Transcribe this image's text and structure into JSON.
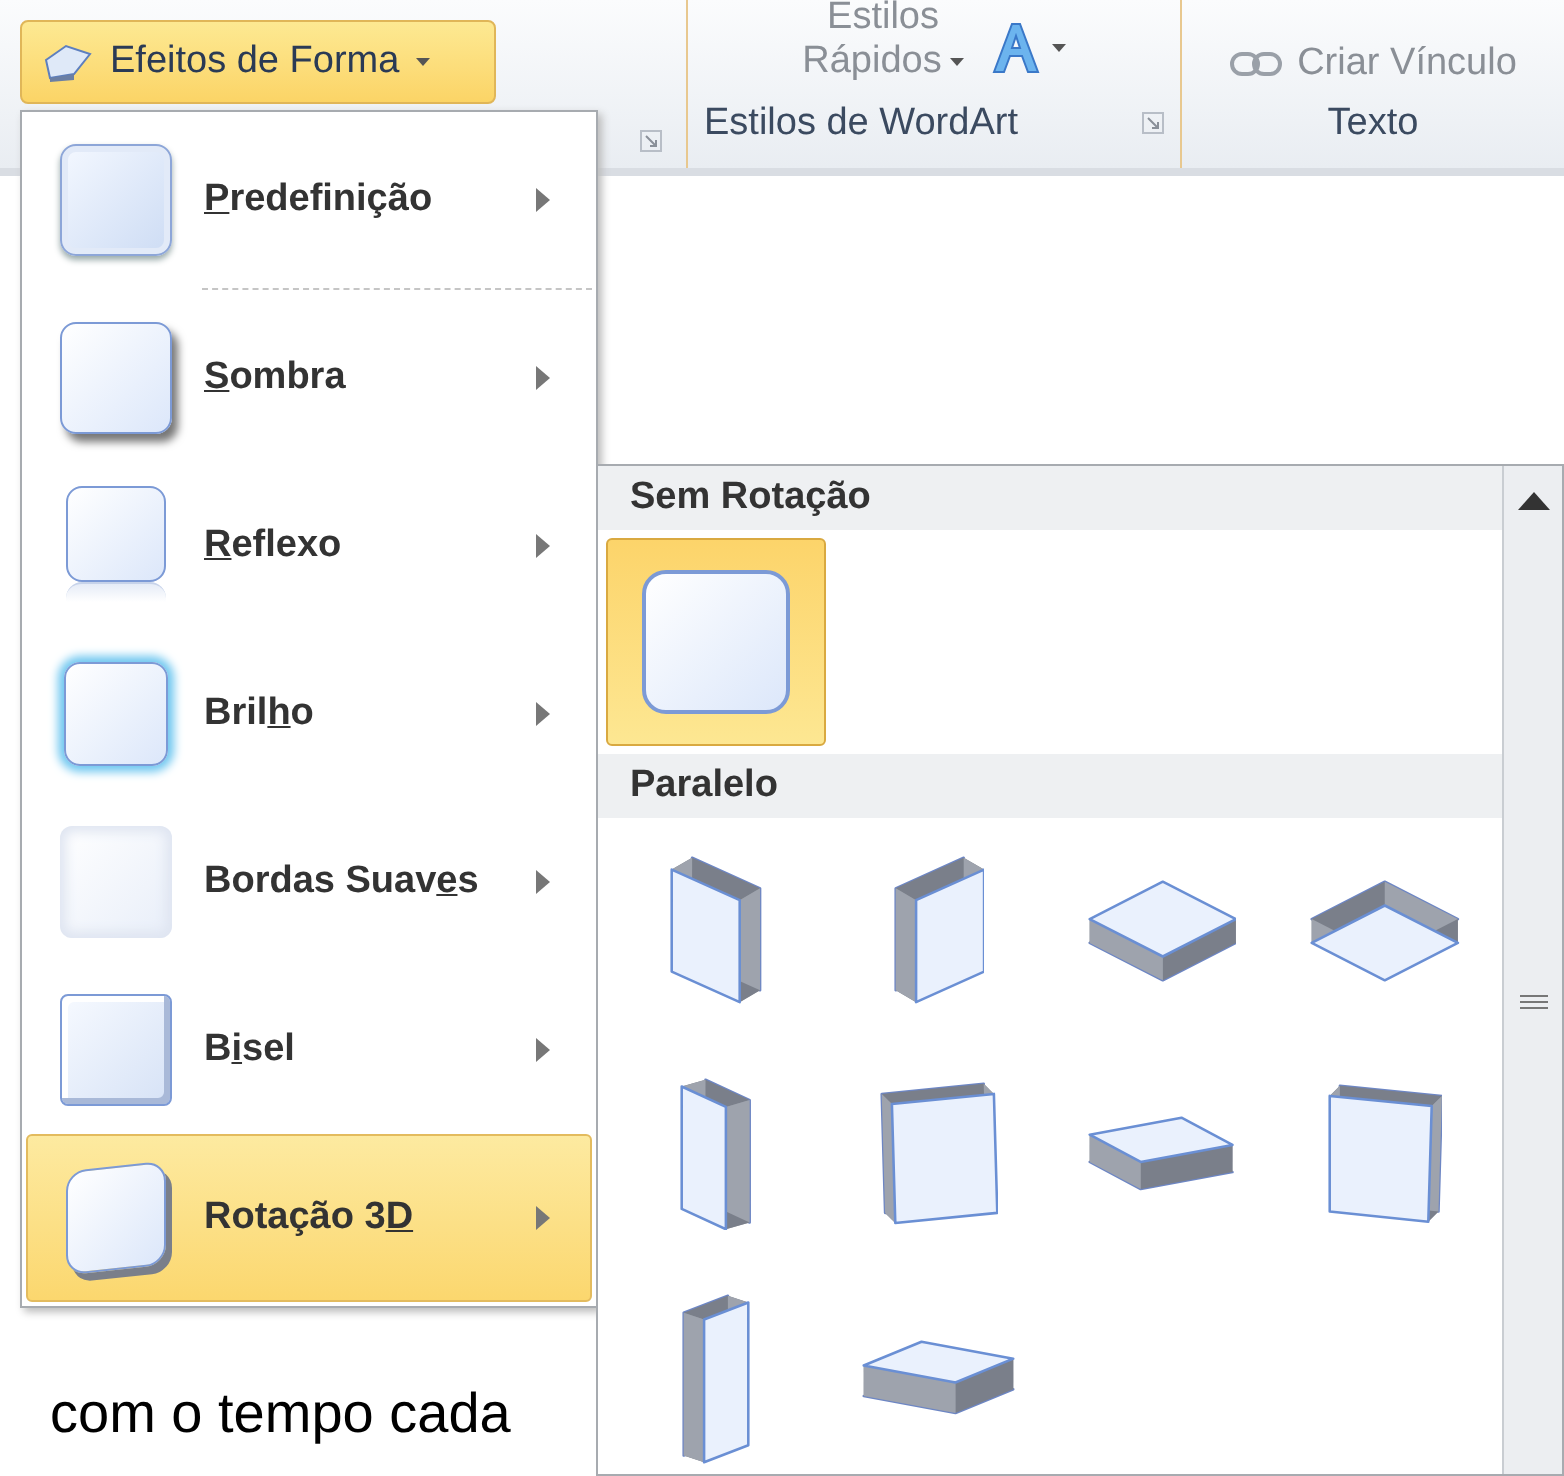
{
  "ribbon": {
    "shape_effects_button": {
      "label": "Efeitos de Forma",
      "expanded": true
    },
    "quick_styles": {
      "line_1": "Estilos",
      "line_2": "Rápidos"
    },
    "create_link": "Criar Vínculo",
    "groups": [
      {
        "label": "Estilos de WordArt"
      },
      {
        "label": "Texto"
      }
    ]
  },
  "menu": {
    "items": [
      {
        "key": "P",
        "after": "redefinição",
        "selected": false,
        "separator_after": true
      },
      {
        "key": "S",
        "after": "ombra",
        "selected": false,
        "separator_after": false
      },
      {
        "key": "R",
        "after": "eflexo",
        "selected": false,
        "separator_after": false
      },
      {
        "before": "Bril",
        "key": "h",
        "after": "o",
        "selected": false,
        "separator_after": false
      },
      {
        "before": "Bordas Suav",
        "key": "e",
        "after": "s",
        "selected": false,
        "separator_after": false
      },
      {
        "before": "B",
        "key": "i",
        "after": "sel",
        "selected": false,
        "separator_after": false
      },
      {
        "before": "Rotação 3",
        "key": "D",
        "selected": true,
        "separator_after": false
      }
    ]
  },
  "submenu": {
    "sections": [
      {
        "title": "Sem Rotação",
        "items": [
          {
            "selected": true
          }
        ]
      },
      {
        "title": "Paralelo",
        "items": [
          {
            "selected": false
          },
          {
            "selected": false
          },
          {
            "selected": false
          },
          {
            "selected": false
          },
          {
            "selected": false
          },
          {
            "selected": false
          },
          {
            "selected": false
          },
          {
            "selected": false
          },
          {
            "selected": false
          },
          {
            "selected": false
          }
        ]
      }
    ]
  },
  "document": {
    "text": "com o tempo cada"
  }
}
